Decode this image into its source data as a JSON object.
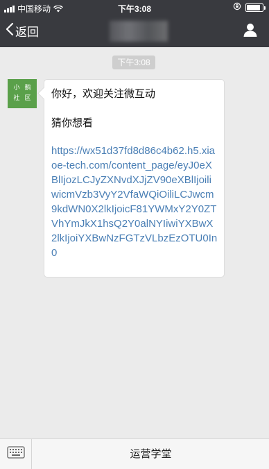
{
  "status_bar": {
    "carrier": "中国移动",
    "time": "下午3:08",
    "signal_bars": 4,
    "battery_level": 0.85,
    "icons": [
      "signal-icon",
      "wifi-icon",
      "orientation-lock-icon",
      "battery-icon"
    ]
  },
  "nav": {
    "back_label": "返回",
    "icons": [
      "chevron-left-icon",
      "person-icon"
    ]
  },
  "chat": {
    "timestamp": "下午3:08",
    "avatar_chars": [
      "小",
      "鹅",
      "社",
      "区"
    ],
    "messages": [
      {
        "text": "你好，欢迎关注微互动"
      },
      {
        "text": "猜你想看"
      }
    ],
    "link": "https://wx51d37fd8d86c4b62.h5.xiaoe-tech.com/content_page/eyJ0eXBlIjozLCJyZXNvdXJjZV90eXBlIjoiliwicmVzb3VyY2VfaWQiOiliLCJwcm9kdWN0X2lkIjoicF81YWMxY2Y0ZTVhYmJkX1hsQ2Y0alNYIiwiYXBwX2lkIjoiYXBwNzFGTzVLbzEzOTU0In0"
  },
  "bottom_bar": {
    "menu_label": "运营学堂",
    "icons": [
      "keyboard-icon"
    ]
  },
  "colors": {
    "nav_bg": "#393a3f",
    "chat_bg": "#ebebeb",
    "link": "#4a7fb5",
    "avatar_bg": "#5aa04a"
  }
}
